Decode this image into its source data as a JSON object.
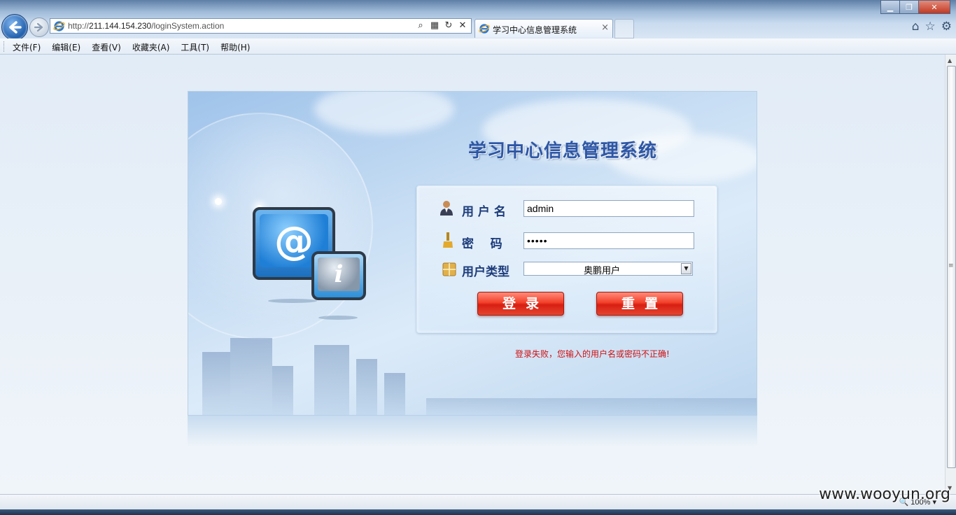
{
  "browser": {
    "url_prefix": "http://",
    "url_host": "211.144.154.230",
    "url_path": "/loginSystem.action",
    "tab_title": "学习中心信息管理系统",
    "tab_close": "×",
    "window_minimize": "▁",
    "window_restore": "❐",
    "window_close": "✕"
  },
  "menu": [
    "文件(F)",
    "编辑(E)",
    "查看(V)",
    "收藏夹(A)",
    "工具(T)",
    "帮助(H)"
  ],
  "login": {
    "system_title": "学习中心信息管理系统",
    "username_label": "用 户 名",
    "password_label": "密    码",
    "usertype_label": "用户类型",
    "username_value": "admin",
    "password_value": "•••••",
    "usertype_value": "奥鹏用户",
    "login_button": "登录",
    "reset_button": "重置",
    "error_message": "登录失败，您输入的用户名或密码不正确!"
  },
  "status": {
    "zoom": "100%"
  },
  "watermark": "www.wooyun.org",
  "colors": {
    "accent": "#2e57a6",
    "button_red": "#e6452f",
    "error_text": "#d01010"
  }
}
